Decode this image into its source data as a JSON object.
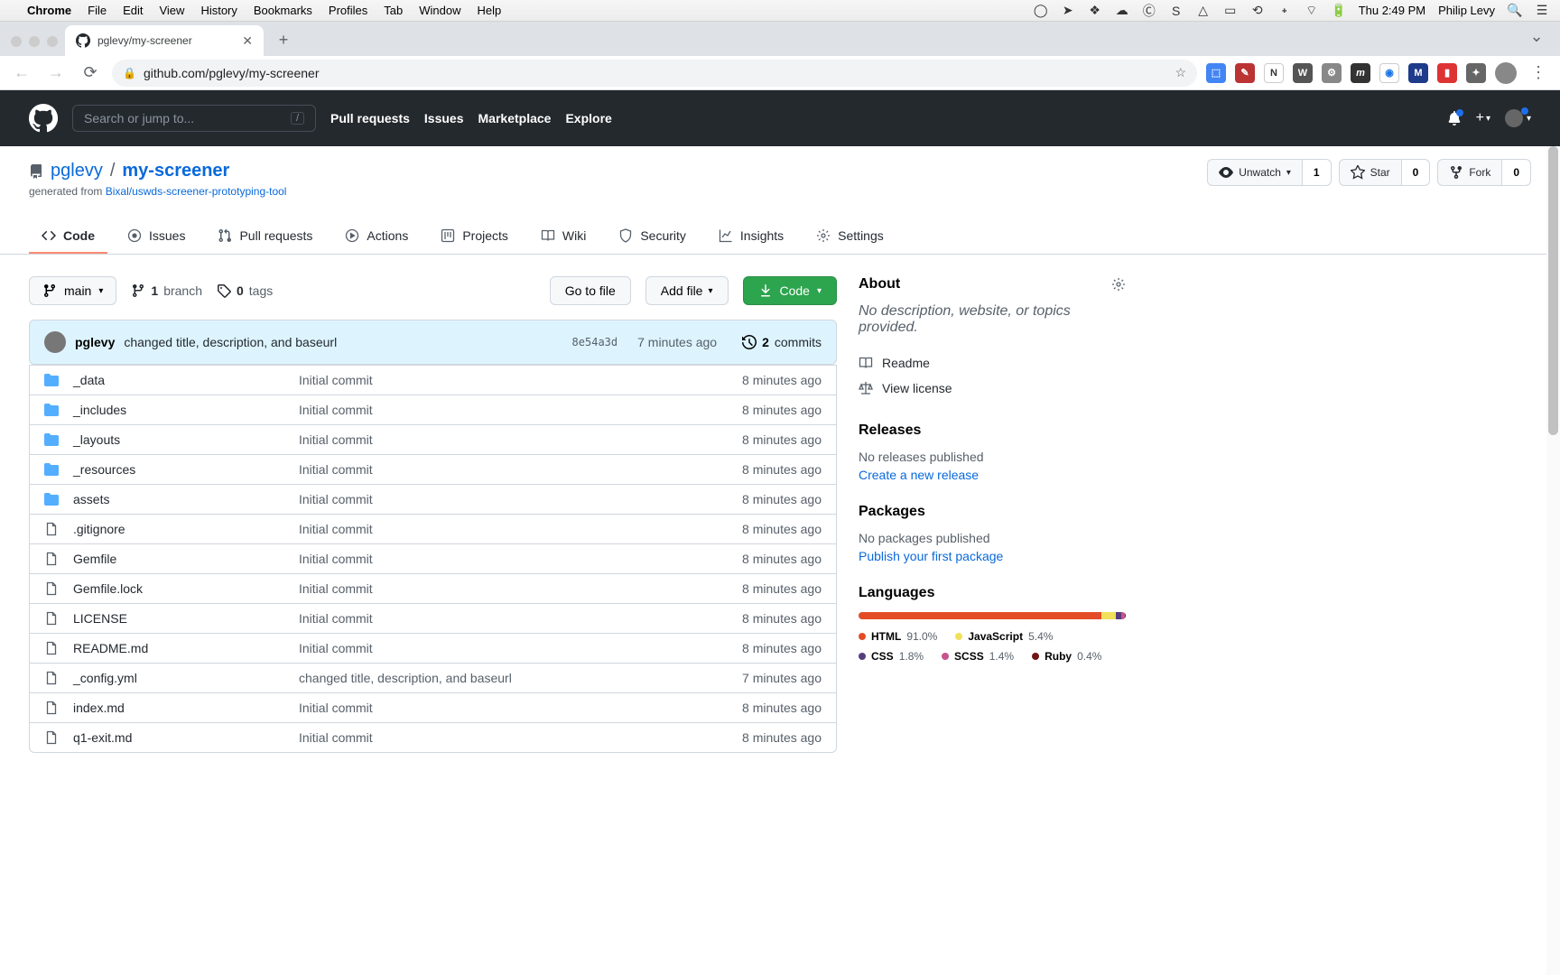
{
  "menubar": {
    "app": "Chrome",
    "items": [
      "File",
      "Edit",
      "View",
      "History",
      "Bookmarks",
      "Profiles",
      "Tab",
      "Window",
      "Help"
    ],
    "clock": "Thu 2:49 PM",
    "user": "Philip Levy"
  },
  "chrome": {
    "tab_title": "pglevy/my-screener",
    "url": "github.com/pglevy/my-screener"
  },
  "gh_header": {
    "search_placeholder": "Search or jump to...",
    "nav": [
      "Pull requests",
      "Issues",
      "Marketplace",
      "Explore"
    ]
  },
  "repo": {
    "owner": "pglevy",
    "name": "my-screener",
    "generated_prefix": "generated from ",
    "generated_link": "Bixal/uswds-screener-prototyping-tool",
    "watch_label": "Unwatch",
    "watch_count": "1",
    "star_label": "Star",
    "star_count": "0",
    "fork_label": "Fork",
    "fork_count": "0"
  },
  "tabs": [
    "Code",
    "Issues",
    "Pull requests",
    "Actions",
    "Projects",
    "Wiki",
    "Security",
    "Insights",
    "Settings"
  ],
  "filenav": {
    "branch": "main",
    "branches_n": "1",
    "branches_t": "branch",
    "tags_n": "0",
    "tags_t": "tags",
    "goto": "Go to file",
    "addfile": "Add file",
    "code": "Code"
  },
  "commit": {
    "author": "pglevy",
    "msg": "changed title, description, and baseurl",
    "hash": "8e54a3d",
    "time": "7 minutes ago",
    "commits_n": "2",
    "commits_t": "commits"
  },
  "files": [
    {
      "type": "dir",
      "name": "_data",
      "msg": "Initial commit",
      "age": "8 minutes ago"
    },
    {
      "type": "dir",
      "name": "_includes",
      "msg": "Initial commit",
      "age": "8 minutes ago"
    },
    {
      "type": "dir",
      "name": "_layouts",
      "msg": "Initial commit",
      "age": "8 minutes ago"
    },
    {
      "type": "dir",
      "name": "_resources",
      "msg": "Initial commit",
      "age": "8 minutes ago"
    },
    {
      "type": "dir",
      "name": "assets",
      "msg": "Initial commit",
      "age": "8 minutes ago"
    },
    {
      "type": "file",
      "name": ".gitignore",
      "msg": "Initial commit",
      "age": "8 minutes ago"
    },
    {
      "type": "file",
      "name": "Gemfile",
      "msg": "Initial commit",
      "age": "8 minutes ago"
    },
    {
      "type": "file",
      "name": "Gemfile.lock",
      "msg": "Initial commit",
      "age": "8 minutes ago"
    },
    {
      "type": "file",
      "name": "LICENSE",
      "msg": "Initial commit",
      "age": "8 minutes ago"
    },
    {
      "type": "file",
      "name": "README.md",
      "msg": "Initial commit",
      "age": "8 minutes ago"
    },
    {
      "type": "file",
      "name": "_config.yml",
      "msg": "changed title, description, and baseurl",
      "age": "7 minutes ago"
    },
    {
      "type": "file",
      "name": "index.md",
      "msg": "Initial commit",
      "age": "8 minutes ago"
    },
    {
      "type": "file",
      "name": "q1-exit.md",
      "msg": "Initial commit",
      "age": "8 minutes ago"
    }
  ],
  "about": {
    "title": "About",
    "desc": "No description, website, or topics provided.",
    "readme": "Readme",
    "license": "View license"
  },
  "releases": {
    "title": "Releases",
    "none": "No releases published",
    "create": "Create a new release"
  },
  "packages": {
    "title": "Packages",
    "none": "No packages published",
    "publish": "Publish your first package"
  },
  "languages": {
    "title": "Languages",
    "items": [
      {
        "name": "HTML",
        "pct": "91.0%",
        "color": "#e34c26"
      },
      {
        "name": "JavaScript",
        "pct": "5.4%",
        "color": "#f1e05a"
      },
      {
        "name": "CSS",
        "pct": "1.8%",
        "color": "#563d7c"
      },
      {
        "name": "SCSS",
        "pct": "1.4%",
        "color": "#c6538c"
      },
      {
        "name": "Ruby",
        "pct": "0.4%",
        "color": "#701516"
      }
    ]
  }
}
